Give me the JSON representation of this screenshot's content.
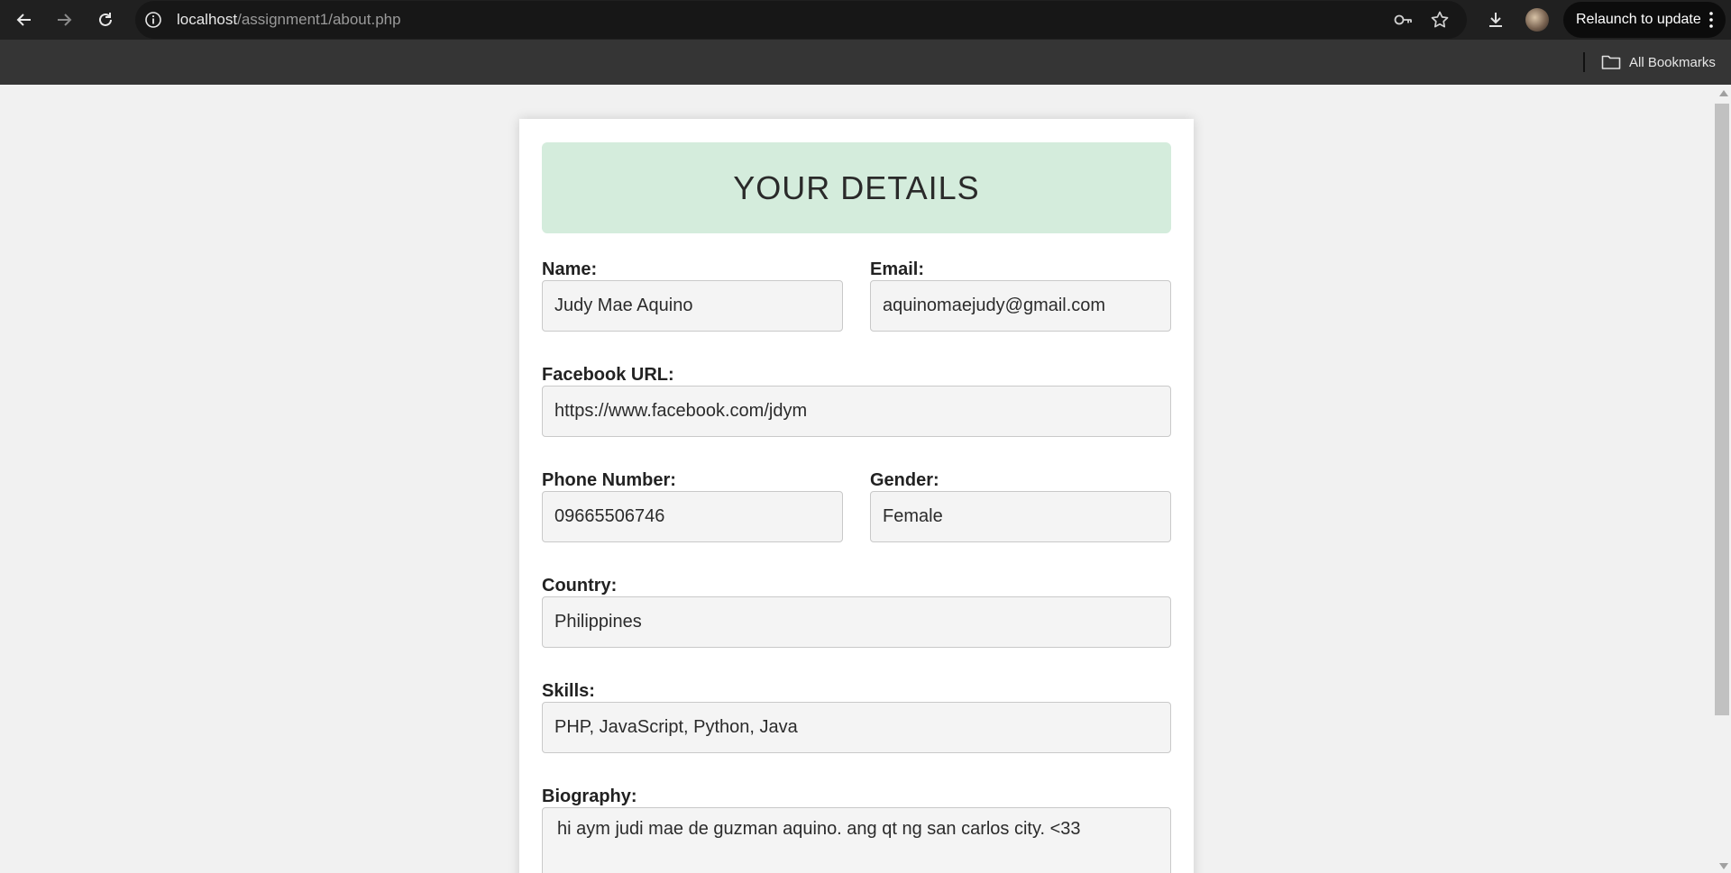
{
  "browser": {
    "url_host": "localhost",
    "url_path": "/assignment1/about.php",
    "relaunch_label": "Relaunch to update",
    "all_bookmarks_label": "All Bookmarks"
  },
  "page": {
    "title": "YOUR DETAILS",
    "fields": {
      "name": {
        "label": "Name:",
        "value": "Judy Mae Aquino"
      },
      "email": {
        "label": "Email:",
        "value": "aquinomaejudy@gmail.com"
      },
      "facebook": {
        "label": "Facebook URL:",
        "value": "https://www.facebook.com/jdym"
      },
      "phone": {
        "label": "Phone Number:",
        "value": "09665506746"
      },
      "gender": {
        "label": "Gender:",
        "value": "Female"
      },
      "country": {
        "label": "Country:",
        "value": "Philippines"
      },
      "skills": {
        "label": "Skills:",
        "value": "PHP, JavaScript, Python, Java"
      },
      "biography": {
        "label": "Biography:",
        "value": "hi aym judi mae de guzman aquino. ang qt ng san carlos city. <33"
      }
    }
  },
  "colors": {
    "header_bg": "#d4ecdc",
    "page_bg": "#f1f1f1",
    "field_bg": "#f4f4f4"
  },
  "icons": [
    "back-icon",
    "forward-icon",
    "reload-icon",
    "site-info-icon",
    "password-key-icon",
    "bookmark-star-icon",
    "download-icon",
    "profile-avatar",
    "more-menu-icon",
    "folder-icon"
  ]
}
